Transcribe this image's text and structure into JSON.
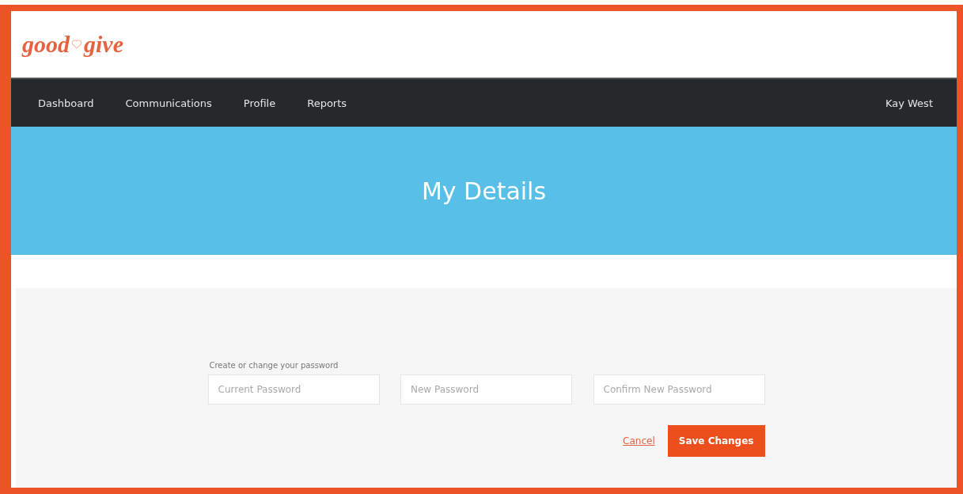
{
  "logo": {
    "left": "good",
    "right": "give"
  },
  "nav": {
    "items": [
      {
        "label": "Dashboard"
      },
      {
        "label": "Communications"
      },
      {
        "label": "Profile"
      },
      {
        "label": "Reports"
      }
    ],
    "user": "Kay West"
  },
  "banner": {
    "title": "My Details"
  },
  "password_form": {
    "label": "Create or change your password",
    "fields": [
      {
        "placeholder": "Current Password"
      },
      {
        "placeholder": "New Password"
      },
      {
        "placeholder": "Confirm New Password"
      }
    ],
    "cancel": "Cancel",
    "save": "Save Changes"
  }
}
